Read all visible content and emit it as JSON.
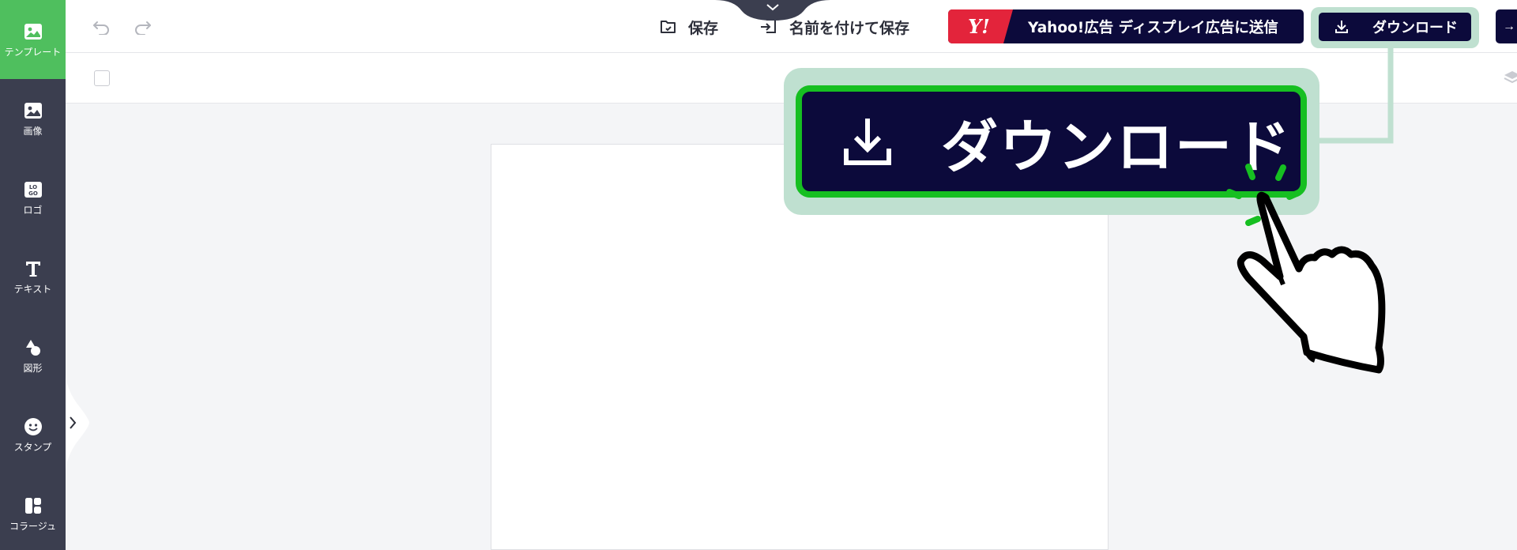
{
  "sidebar": {
    "items": [
      {
        "label": "テンプレート",
        "icon": "template-icon",
        "active": true
      },
      {
        "label": "画像",
        "icon": "image-icon"
      },
      {
        "label": "ロゴ",
        "icon": "logo-icon"
      },
      {
        "label": "テキスト",
        "icon": "text-icon"
      },
      {
        "label": "図形",
        "icon": "shape-icon"
      },
      {
        "label": "スタンプ",
        "icon": "stamp-icon"
      },
      {
        "label": "コラージュ",
        "icon": "collage-icon"
      }
    ]
  },
  "toolbar": {
    "save_label": "保存",
    "save_as_label": "名前を付けて保存",
    "yahoo_logo_text": "Y!",
    "yahoo_label": "Yahoo!広告 ディスプレイ広告に送信",
    "download_label": "ダウンロード",
    "next_arrow": "→"
  },
  "callout": {
    "download_label": "ダウンロード"
  },
  "colors": {
    "sidebar_bg": "#3b3e4f",
    "active_green": "#4fbf5e",
    "button_navy": "#0c0a3b",
    "yahoo_red": "#e3243b",
    "highlight_mint": "#bfe0d0",
    "callout_border": "#16bf21"
  }
}
